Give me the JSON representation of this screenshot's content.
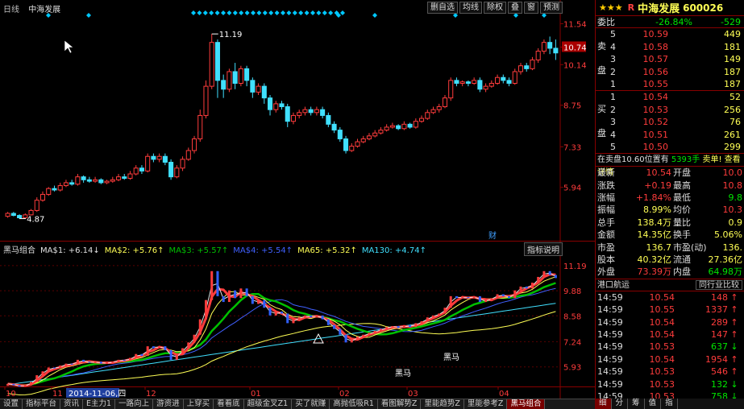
{
  "chart_header": {
    "period": "日线",
    "stock_name": "中海发展"
  },
  "toolbar": [
    "删自选",
    "均线",
    "除权",
    "叠",
    "窗",
    "预测"
  ],
  "price_axis": [
    "11.54",
    "10.74",
    "10.14",
    "8.75",
    "7.33",
    "5.94"
  ],
  "price_axis_highlight": "10.74",
  "annotations": {
    "high": "11.19",
    "low": "4.87",
    "fin_marker": "财"
  },
  "indicator": {
    "name": "黑马组合",
    "items": [
      {
        "text": "MA$1: +6.14↓",
        "color": "#e0e0e0"
      },
      {
        "text": "MA$2: +5.76↑",
        "color": "#ffff55"
      },
      {
        "text": "MA$3: +5.57↑",
        "color": "#00c000"
      },
      {
        "text": "MA$4: +5.54↑",
        "color": "#4060ff"
      },
      {
        "text": "MA65: +5.32↑",
        "color": "#ffff55"
      },
      {
        "text": "MA130: +4.74↑",
        "color": "#40e0ff"
      }
    ],
    "button": "指标说明",
    "axis": [
      "11.19",
      "9.88",
      "8.58",
      "7.24",
      "5.93"
    ],
    "labels": [
      "黑马",
      "黑马"
    ]
  },
  "x_axis": [
    "10",
    "11",
    "2014-11-06,四",
    "12",
    "01",
    "02",
    "03",
    "04"
  ],
  "bottom_tabs": [
    "设置",
    "指标平台",
    "资讯",
    "E主力1",
    "一路向上",
    "游资进",
    "上穿买",
    "看看底",
    "超级金叉Z1",
    "买了就赚",
    "高抛低吸R1",
    "看图解势Z",
    "里能趋势Z",
    "里能参考Z",
    "黑马组合"
  ],
  "panel": {
    "stars": "★★★",
    "r_mark": "R",
    "name": "中海发展",
    "code": "600026",
    "weibi": {
      "label": "委比",
      "pct": "-26.84%",
      "diff": "-529"
    },
    "side_labels": {
      "sell": [
        "卖",
        "盘"
      ],
      "buy": [
        "买",
        "盘"
      ]
    },
    "asks": [
      {
        "lvl": "5",
        "price": "10.59",
        "vol": "449"
      },
      {
        "lvl": "4",
        "price": "10.58",
        "vol": "181"
      },
      {
        "lvl": "3",
        "price": "10.57",
        "vol": "149"
      },
      {
        "lvl": "2",
        "price": "10.56",
        "vol": "187"
      },
      {
        "lvl": "1",
        "price": "10.55",
        "vol": "187"
      }
    ],
    "bids": [
      {
        "lvl": "1",
        "price": "10.54",
        "vol": "52"
      },
      {
        "lvl": "2",
        "price": "10.53",
        "vol": "256"
      },
      {
        "lvl": "3",
        "price": "10.52",
        "vol": "76"
      },
      {
        "lvl": "4",
        "price": "10.51",
        "vol": "261"
      },
      {
        "lvl": "5",
        "price": "10.50",
        "vol": "299"
      }
    ],
    "order_info": {
      "text": "在卖盘10.60位置有",
      "qty": "5393手",
      "tail": "卖单! 查看详情"
    },
    "stats": [
      {
        "k1": "最新",
        "v1": "10.54",
        "c1": "red",
        "k2": "开盘",
        "v2": "10.0",
        "c2": "red"
      },
      {
        "k1": "涨跌",
        "v1": "+0.19",
        "c1": "red",
        "k2": "最高",
        "v2": "10.8",
        "c2": "red"
      },
      {
        "k1": "涨幅",
        "v1": "+1.84%",
        "c1": "red",
        "k2": "最低",
        "v2": "9.8",
        "c2": "green"
      },
      {
        "k1": "振幅",
        "v1": "8.99%",
        "c1": "yellow",
        "k2": "均价",
        "v2": "10.3",
        "c2": "red"
      },
      {
        "k1": "总手",
        "v1": "138.4万",
        "c1": "yellow",
        "k2": "量比",
        "v2": "0.9",
        "c2": "yellow"
      },
      {
        "k1": "金额",
        "v1": "14.35亿",
        "c1": "yellow",
        "k2": "换手",
        "v2": "5.06%",
        "c2": "yellow"
      },
      {
        "k1": "市盈",
        "v1": "136.7",
        "c1": "yellow",
        "k2": "市盈(动)",
        "v2": "136.",
        "c2": "yellow"
      },
      {
        "k1": "股本",
        "v1": "40.32亿",
        "c1": "yellow",
        "k2": "流通",
        "v2": "27.36亿",
        "c2": "yellow"
      },
      {
        "k1": "外盘",
        "v1": "73.39万",
        "c1": "red",
        "k2": "内盘",
        "v2": "64.98万",
        "c2": "green"
      }
    ],
    "trades_header": {
      "left": "港口航运",
      "right": "同行业比较"
    },
    "trades": [
      {
        "t": "14:59",
        "p": "10.54",
        "v": "148",
        "d": "up"
      },
      {
        "t": "14:59",
        "p": "10.55",
        "v": "1337",
        "d": "up"
      },
      {
        "t": "14:59",
        "p": "10.54",
        "v": "289",
        "d": "up"
      },
      {
        "t": "14:59",
        "p": "10.54",
        "v": "147",
        "d": "up"
      },
      {
        "t": "14:59",
        "p": "10.53",
        "v": "637",
        "d": "down"
      },
      {
        "t": "14:59",
        "p": "10.54",
        "v": "1954",
        "d": "up"
      },
      {
        "t": "14:59",
        "p": "10.53",
        "v": "546",
        "d": "up"
      },
      {
        "t": "14:59",
        "p": "10.53",
        "v": "132",
        "d": "down"
      },
      {
        "t": "14:59",
        "p": "10.53",
        "v": "758",
        "d": "down"
      },
      {
        "t": "14:59",
        "p": "10.54",
        "v": "1198",
        "d": "down"
      }
    ],
    "panel_tabs": [
      "细",
      "分",
      "筹",
      "值",
      "指"
    ]
  },
  "colors": {
    "up": "#ff3c3c",
    "down": "#40e0ff",
    "frame": "#800000",
    "accent": "#00c8ff"
  },
  "chart_data": {
    "type": "candlestick",
    "ylim": [
      4.5,
      11.8
    ],
    "high_label": 11.19,
    "low_label": 4.87,
    "candles": [
      [
        4.95,
        5.05,
        4.9,
        5.1
      ],
      [
        5.05,
        4.98,
        4.95,
        5.1
      ],
      [
        4.98,
        4.9,
        4.87,
        5.02
      ],
      [
        4.9,
        5.0,
        4.88,
        5.05
      ],
      [
        5.0,
        5.15,
        4.98,
        5.2
      ],
      [
        5.15,
        5.5,
        5.1,
        5.6
      ],
      [
        5.5,
        5.7,
        5.45,
        5.8
      ],
      [
        5.7,
        5.9,
        5.65,
        5.95
      ],
      [
        5.9,
        5.85,
        5.8,
        6.0
      ],
      [
        5.85,
        6.0,
        5.8,
        6.1
      ],
      [
        6.0,
        6.1,
        5.95,
        6.2
      ],
      [
        6.1,
        6.05,
        6.0,
        6.2
      ],
      [
        6.05,
        6.3,
        6.0,
        6.4
      ],
      [
        6.3,
        6.2,
        6.1,
        6.35
      ],
      [
        6.2,
        6.15,
        6.1,
        6.3
      ],
      [
        6.15,
        6.2,
        6.1,
        6.3
      ],
      [
        6.2,
        6.1,
        6.05,
        6.25
      ],
      [
        6.1,
        6.15,
        6.05,
        6.2
      ],
      [
        6.15,
        6.2,
        6.1,
        6.3
      ],
      [
        6.2,
        6.3,
        6.15,
        6.4
      ],
      [
        6.3,
        6.25,
        6.2,
        6.4
      ],
      [
        6.25,
        6.4,
        6.2,
        6.5
      ],
      [
        6.4,
        6.6,
        6.35,
        6.7
      ],
      [
        6.6,
        6.5,
        6.4,
        6.7
      ],
      [
        6.5,
        7.0,
        6.45,
        7.1
      ],
      [
        7.0,
        6.9,
        6.8,
        7.1
      ],
      [
        6.9,
        7.0,
        6.8,
        7.1
      ],
      [
        7.0,
        6.8,
        6.7,
        7.1
      ],
      [
        6.8,
        6.3,
        6.2,
        6.9
      ],
      [
        6.3,
        6.6,
        6.25,
        6.7
      ],
      [
        6.6,
        6.9,
        6.5,
        7.0
      ],
      [
        6.9,
        7.2,
        6.85,
        7.3
      ],
      [
        7.2,
        7.6,
        7.1,
        7.7
      ],
      [
        7.6,
        8.4,
        7.5,
        8.6
      ],
      [
        8.4,
        9.4,
        8.3,
        9.6
      ],
      [
        9.4,
        10.9,
        9.3,
        11.19
      ],
      [
        10.9,
        9.6,
        9.0,
        11.0
      ],
      [
        9.6,
        9.3,
        9.0,
        9.8
      ],
      [
        9.3,
        9.9,
        9.2,
        10.0
      ],
      [
        9.9,
        9.5,
        9.3,
        10.2
      ],
      [
        9.5,
        10.0,
        9.4,
        10.1
      ],
      [
        10.0,
        9.6,
        9.4,
        10.1
      ],
      [
        9.6,
        9.2,
        9.0,
        9.7
      ],
      [
        9.2,
        9.4,
        9.1,
        9.5
      ],
      [
        9.4,
        9.0,
        8.8,
        9.5
      ],
      [
        9.0,
        8.6,
        8.4,
        9.1
      ],
      [
        8.6,
        8.8,
        8.5,
        8.9
      ],
      [
        8.8,
        8.7,
        8.6,
        8.9
      ],
      [
        8.7,
        8.2,
        8.0,
        8.8
      ],
      [
        8.2,
        8.4,
        8.1,
        8.5
      ],
      [
        8.4,
        8.5,
        8.3,
        8.6
      ],
      [
        8.5,
        8.6,
        8.4,
        8.7
      ],
      [
        8.6,
        8.5,
        8.4,
        8.7
      ],
      [
        8.5,
        8.6,
        8.4,
        8.7
      ],
      [
        8.6,
        8.4,
        8.3,
        8.7
      ],
      [
        8.4,
        8.1,
        8.0,
        8.5
      ],
      [
        8.1,
        7.9,
        7.8,
        8.2
      ],
      [
        7.9,
        7.6,
        7.5,
        8.0
      ],
      [
        7.6,
        7.2,
        7.1,
        7.7
      ],
      [
        7.2,
        7.35,
        7.15,
        7.45
      ],
      [
        7.35,
        7.5,
        7.3,
        7.6
      ],
      [
        7.5,
        7.6,
        7.45,
        7.7
      ],
      [
        7.6,
        7.7,
        7.55,
        7.8
      ],
      [
        7.7,
        7.8,
        7.65,
        7.9
      ],
      [
        7.8,
        7.9,
        7.75,
        8.0
      ],
      [
        7.9,
        8.0,
        7.85,
        8.1
      ],
      [
        8.0,
        8.05,
        7.95,
        8.15
      ],
      [
        8.05,
        7.95,
        7.9,
        8.1
      ],
      [
        7.95,
        8.1,
        7.9,
        8.2
      ],
      [
        8.1,
        8.0,
        7.95,
        8.15
      ],
      [
        8.0,
        8.2,
        7.95,
        8.3
      ],
      [
        8.2,
        8.3,
        8.15,
        8.4
      ],
      [
        8.3,
        8.5,
        8.25,
        8.6
      ],
      [
        8.5,
        8.6,
        8.45,
        8.7
      ],
      [
        8.6,
        8.7,
        8.5,
        8.8
      ],
      [
        8.7,
        9.0,
        8.65,
        9.1
      ],
      [
        9.0,
        9.6,
        8.9,
        9.7
      ],
      [
        9.6,
        9.5,
        9.4,
        9.7
      ],
      [
        9.5,
        9.55,
        9.4,
        9.6
      ],
      [
        9.55,
        9.5,
        9.4,
        9.6
      ],
      [
        9.5,
        9.6,
        9.45,
        9.7
      ],
      [
        9.6,
        9.3,
        9.2,
        9.7
      ],
      [
        9.3,
        9.4,
        9.2,
        9.5
      ],
      [
        9.4,
        9.5,
        9.35,
        9.6
      ],
      [
        9.5,
        9.7,
        9.45,
        9.8
      ],
      [
        9.7,
        9.6,
        9.5,
        9.8
      ],
      [
        9.6,
        9.5,
        9.4,
        9.7
      ],
      [
        9.5,
        9.9,
        9.45,
        10.0
      ],
      [
        9.9,
        10.1,
        9.8,
        10.2
      ],
      [
        10.1,
        10.0,
        9.9,
        10.2
      ],
      [
        10.0,
        10.3,
        9.95,
        10.4
      ],
      [
        10.3,
        10.6,
        10.2,
        10.7
      ],
      [
        10.6,
        10.9,
        10.5,
        11.0
      ],
      [
        10.9,
        10.7,
        10.5,
        11.1
      ],
      [
        10.7,
        10.54,
        10.3,
        11.0
      ]
    ]
  }
}
